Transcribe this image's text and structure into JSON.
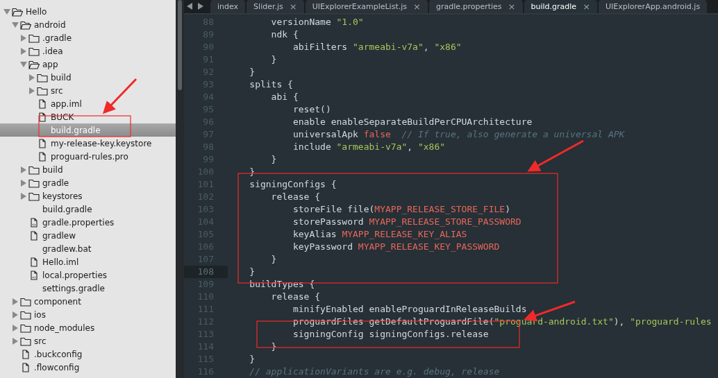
{
  "sidebar": {
    "tree": [
      {
        "label": "Hello",
        "kind": "folder",
        "expanded": true,
        "selected": false,
        "children": [
          {
            "label": "android",
            "kind": "folder",
            "expanded": true,
            "selected": false,
            "children": [
              {
                "label": ".gradle",
                "kind": "folder",
                "expanded": false,
                "selected": false
              },
              {
                "label": ".idea",
                "kind": "folder",
                "expanded": false,
                "selected": false
              },
              {
                "label": "app",
                "kind": "folder",
                "expanded": true,
                "selected": false,
                "children": [
                  {
                    "label": "build",
                    "kind": "folder",
                    "expanded": false,
                    "selected": false
                  },
                  {
                    "label": "src",
                    "kind": "folder",
                    "expanded": false,
                    "selected": false
                  },
                  {
                    "label": "app.iml",
                    "kind": "file",
                    "selected": false
                  },
                  {
                    "label": "BUCK",
                    "kind": "file",
                    "selected": false
                  },
                  {
                    "label": "build.gradle",
                    "kind": "plain",
                    "selected": true
                  },
                  {
                    "label": "my-release-key.keystore",
                    "kind": "file",
                    "selected": false
                  },
                  {
                    "label": "proguard-rules.pro",
                    "kind": "file",
                    "selected": false
                  }
                ]
              },
              {
                "label": "build",
                "kind": "folder",
                "expanded": false,
                "selected": false
              },
              {
                "label": "gradle",
                "kind": "folder",
                "expanded": false,
                "selected": false
              },
              {
                "label": "keystores",
                "kind": "folder",
                "expanded": false,
                "selected": false
              },
              {
                "label": "build.gradle",
                "kind": "plain",
                "selected": false
              },
              {
                "label": "gradle.properties",
                "kind": "config",
                "selected": false
              },
              {
                "label": "gradlew",
                "kind": "file",
                "selected": false
              },
              {
                "label": "gradlew.bat",
                "kind": "plain",
                "selected": false
              },
              {
                "label": "Hello.iml",
                "kind": "file",
                "selected": false
              },
              {
                "label": "local.properties",
                "kind": "config",
                "selected": false
              },
              {
                "label": "settings.gradle",
                "kind": "plain",
                "selected": false
              }
            ]
          },
          {
            "label": "component",
            "kind": "folder",
            "expanded": false,
            "selected": false
          },
          {
            "label": "ios",
            "kind": "folder",
            "expanded": false,
            "selected": false
          },
          {
            "label": "node_modules",
            "kind": "folder",
            "expanded": false,
            "selected": false
          },
          {
            "label": "src",
            "kind": "folder",
            "expanded": false,
            "selected": false
          },
          {
            "label": ".buckconfig",
            "kind": "file",
            "selected": false
          },
          {
            "label": ".flowconfig",
            "kind": "file",
            "selected": false
          }
        ]
      }
    ]
  },
  "tabs": [
    {
      "label": "index",
      "selected": false
    },
    {
      "label": "Slider.js",
      "selected": false,
      "close": "×"
    },
    {
      "label": "UIExplorerExampleList.js",
      "selected": false,
      "close": "×"
    },
    {
      "label": "gradle.properties",
      "selected": false,
      "close": "×"
    },
    {
      "label": "build.gradle",
      "selected": true,
      "close": "×"
    },
    {
      "label": "UIExplorerApp.android.js",
      "selected": false
    }
  ],
  "editor": {
    "lines": [
      {
        "number": "88",
        "current": false,
        "tokens": [
          {
            "kind": "plain",
            "text": "        versionName "
          },
          {
            "kind": "string",
            "text": "\"1.0\""
          }
        ]
      },
      {
        "number": "89",
        "current": false,
        "tokens": [
          {
            "kind": "plain",
            "text": "        ndk {"
          }
        ]
      },
      {
        "number": "90",
        "current": false,
        "tokens": [
          {
            "kind": "plain",
            "text": "            abiFilters "
          },
          {
            "kind": "string",
            "text": "\"armeabi-v7a\""
          },
          {
            "kind": "plain",
            "text": ", "
          },
          {
            "kind": "string",
            "text": "\"x86\""
          }
        ]
      },
      {
        "number": "91",
        "current": false,
        "tokens": [
          {
            "kind": "plain",
            "text": "        }"
          }
        ]
      },
      {
        "number": "92",
        "current": false,
        "tokens": [
          {
            "kind": "plain",
            "text": "    }"
          }
        ]
      },
      {
        "number": "93",
        "current": false,
        "tokens": [
          {
            "kind": "plain",
            "text": "    splits {"
          }
        ]
      },
      {
        "number": "94",
        "current": false,
        "tokens": [
          {
            "kind": "plain",
            "text": "        abi {"
          }
        ]
      },
      {
        "number": "95",
        "current": false,
        "tokens": [
          {
            "kind": "plain",
            "text": "            reset()"
          }
        ]
      },
      {
        "number": "96",
        "current": false,
        "tokens": [
          {
            "kind": "plain",
            "text": "            enable enableSeparateBuildPerCPUArchitecture"
          }
        ]
      },
      {
        "number": "97",
        "current": false,
        "tokens": [
          {
            "kind": "plain",
            "text": "            universalApk "
          },
          {
            "kind": "keyword",
            "text": "false"
          },
          {
            "kind": "comment",
            "text": "  // If true, also generate a universal APK"
          }
        ]
      },
      {
        "number": "98",
        "current": false,
        "tokens": [
          {
            "kind": "plain",
            "text": "            include "
          },
          {
            "kind": "string",
            "text": "\"armeabi-v7a\""
          },
          {
            "kind": "plain",
            "text": ", "
          },
          {
            "kind": "string",
            "text": "\"x86\""
          }
        ]
      },
      {
        "number": "99",
        "current": false,
        "tokens": [
          {
            "kind": "plain",
            "text": "        }"
          }
        ]
      },
      {
        "number": "100",
        "current": false,
        "tokens": [
          {
            "kind": "plain",
            "text": "    }"
          }
        ]
      },
      {
        "number": "101",
        "current": false,
        "tokens": [
          {
            "kind": "plain",
            "text": "    signingConfigs {"
          }
        ]
      },
      {
        "number": "102",
        "current": false,
        "tokens": [
          {
            "kind": "plain",
            "text": "        release {"
          }
        ]
      },
      {
        "number": "103",
        "current": false,
        "tokens": [
          {
            "kind": "plain",
            "text": "            storeFile file("
          },
          {
            "kind": "constant",
            "text": "MYAPP_RELEASE_STORE_FILE"
          },
          {
            "kind": "plain",
            "text": ")"
          }
        ]
      },
      {
        "number": "104",
        "current": false,
        "tokens": [
          {
            "kind": "plain",
            "text": "            storePassword "
          },
          {
            "kind": "constant",
            "text": "MYAPP_RELEASE_STORE_PASSWORD"
          }
        ]
      },
      {
        "number": "105",
        "current": false,
        "tokens": [
          {
            "kind": "plain",
            "text": "            keyAlias "
          },
          {
            "kind": "constant",
            "text": "MYAPP_RELEASE_KEY_ALIAS"
          }
        ]
      },
      {
        "number": "106",
        "current": false,
        "tokens": [
          {
            "kind": "plain",
            "text": "            keyPassword "
          },
          {
            "kind": "constant",
            "text": "MYAPP_RELEASE_KEY_PASSWORD"
          }
        ]
      },
      {
        "number": "107",
        "current": false,
        "tokens": [
          {
            "kind": "plain",
            "text": "        }"
          }
        ]
      },
      {
        "number": "108",
        "current": true,
        "tokens": [
          {
            "kind": "plain",
            "text": "    }"
          }
        ]
      },
      {
        "number": "109",
        "current": false,
        "tokens": [
          {
            "kind": "plain",
            "text": "    buildTypes {"
          }
        ]
      },
      {
        "number": "110",
        "current": false,
        "tokens": [
          {
            "kind": "plain",
            "text": "        release {"
          }
        ]
      },
      {
        "number": "111",
        "current": false,
        "tokens": [
          {
            "kind": "plain",
            "text": "            minifyEnabled enableProguardInReleaseBuilds"
          }
        ]
      },
      {
        "number": "112",
        "current": false,
        "tokens": [
          {
            "kind": "plain",
            "text": "            proguardFiles getDefaultProguardFile("
          },
          {
            "kind": "string",
            "text": "\"proguard-android.txt\""
          },
          {
            "kind": "plain",
            "text": "), "
          },
          {
            "kind": "string",
            "text": "\"proguard-rules"
          }
        ]
      },
      {
        "number": "113",
        "current": false,
        "tokens": [
          {
            "kind": "plain",
            "text": "            signingConfig signingConfigs.release"
          }
        ]
      },
      {
        "number": "114",
        "current": false,
        "tokens": [
          {
            "kind": "plain",
            "text": "        }"
          }
        ]
      },
      {
        "number": "115",
        "current": false,
        "tokens": [
          {
            "kind": "plain",
            "text": "    }"
          }
        ]
      },
      {
        "number": "116",
        "current": false,
        "tokens": [
          {
            "kind": "comment",
            "text": "    // applicationVariants are e.g. debug, release"
          }
        ]
      }
    ]
  }
}
